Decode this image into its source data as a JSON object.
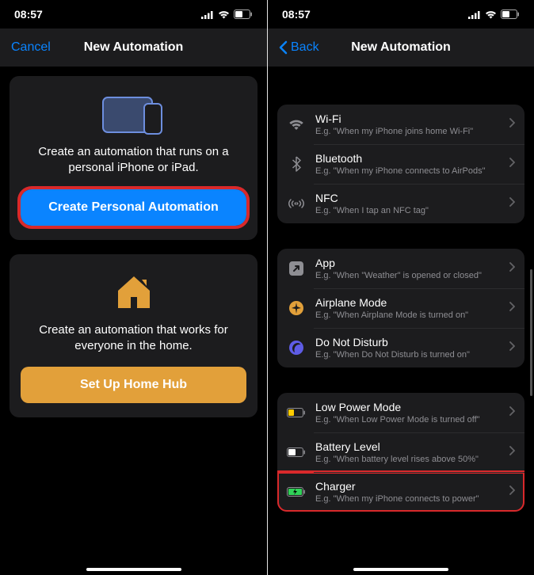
{
  "status": {
    "time": "08:57"
  },
  "left": {
    "nav": {
      "cancel": "Cancel",
      "title": "New Automation"
    },
    "card_personal": {
      "desc": "Create an automation that runs on a personal iPhone or iPad.",
      "button": "Create Personal Automation"
    },
    "card_home": {
      "desc": "Create an automation that works for everyone in the home.",
      "button": "Set Up Home Hub"
    }
  },
  "right": {
    "nav": {
      "back": "Back",
      "title": "New Automation"
    },
    "section1": {
      "wifi": {
        "title": "Wi-Fi",
        "sub": "E.g. \"When my iPhone joins home Wi-Fi\""
      },
      "bluetooth": {
        "title": "Bluetooth",
        "sub": "E.g. \"When my iPhone connects to AirPods\""
      },
      "nfc": {
        "title": "NFC",
        "sub": "E.g. \"When I tap an NFC tag\""
      }
    },
    "section2": {
      "app": {
        "title": "App",
        "sub": "E.g. \"When \"Weather\" is opened or closed\""
      },
      "airplane": {
        "title": "Airplane Mode",
        "sub": "E.g. \"When Airplane Mode is turned on\""
      },
      "dnd": {
        "title": "Do Not Disturb",
        "sub": "E.g. \"When Do Not Disturb is turned on\""
      }
    },
    "section3": {
      "lowpower": {
        "title": "Low Power Mode",
        "sub": "E.g. \"When Low Power Mode is turned off\""
      },
      "battery": {
        "title": "Battery Level",
        "sub": "E.g. \"When battery level rises above 50%\""
      },
      "charger": {
        "title": "Charger",
        "sub": "E.g. \"When my iPhone connects to power\""
      }
    }
  }
}
